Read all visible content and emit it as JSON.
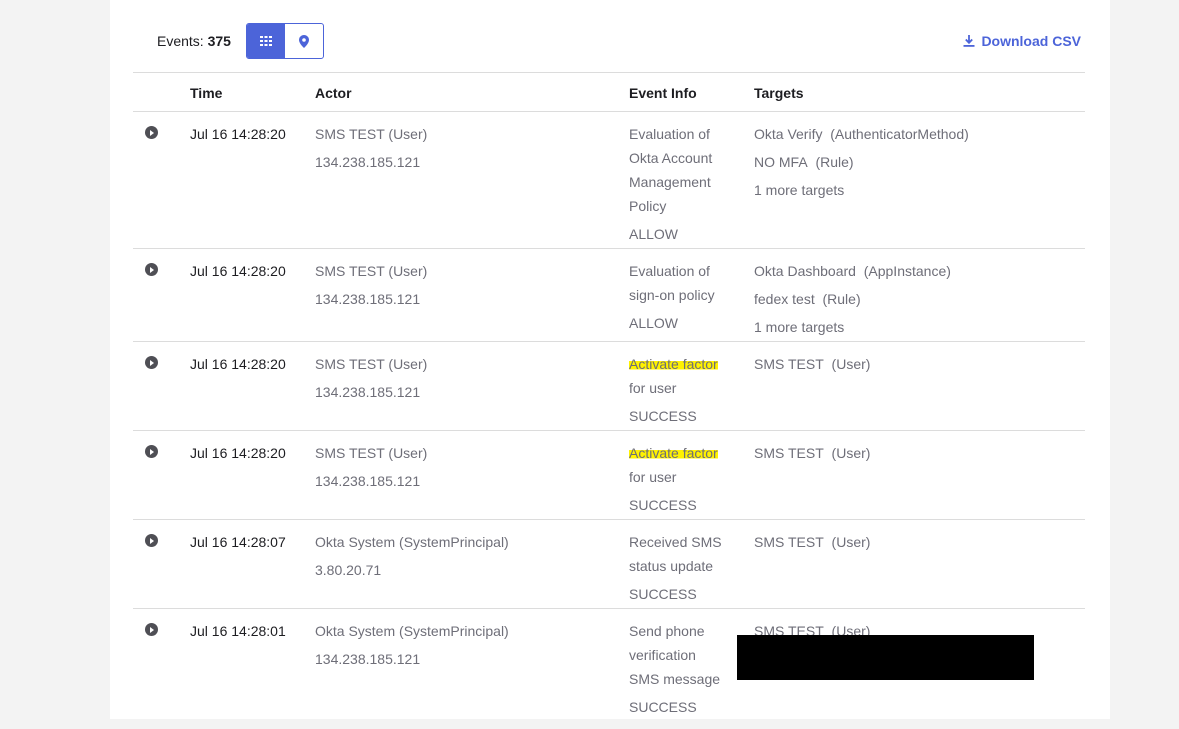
{
  "toolbar": {
    "events_label": "Events:",
    "events_count": "375",
    "grid_view_icon": "grid-icon",
    "map_view_icon": "map-pin-icon",
    "download_label": "Download CSV",
    "download_icon": "download-icon",
    "accent_color": "#4c64d9"
  },
  "columns": {
    "time": "Time",
    "actor": "Actor",
    "event_info": "Event Info",
    "targets": "Targets"
  },
  "rows": [
    {
      "time": "Jul 16 14:28:20",
      "actor_name": "SMS TEST",
      "actor_type": "(User)",
      "actor_ip": "134.238.185.121",
      "info_lines": [
        "Evaluation of",
        "Okta Account",
        "Management",
        "Policy"
      ],
      "outcome": "ALLOW",
      "targets": [
        {
          "name": "Okta Verify",
          "type": "(AuthenticatorMethod)"
        },
        {
          "name": "NO MFA",
          "type": "(Rule)"
        }
      ],
      "more_targets": "1 more targets"
    },
    {
      "time": "Jul 16 14:28:20",
      "actor_name": "SMS TEST",
      "actor_type": "(User)",
      "actor_ip": "134.238.185.121",
      "info_lines": [
        "Evaluation of",
        "sign-on policy"
      ],
      "outcome": "ALLOW",
      "targets": [
        {
          "name": "Okta Dashboard",
          "type": "(AppInstance)"
        },
        {
          "name": "fedex test",
          "type": "(Rule)"
        }
      ],
      "more_targets": "1 more targets"
    },
    {
      "time": "Jul 16 14:28:20",
      "actor_name": "SMS TEST",
      "actor_type": "(User)",
      "actor_ip": "134.238.185.121",
      "info_lines": [
        "Activate factor",
        "for user"
      ],
      "outcome": "SUCCESS",
      "targets": [
        {
          "name": "SMS TEST",
          "type": "(User)"
        }
      ],
      "more_targets": ""
    },
    {
      "time": "Jul 16 14:28:20",
      "actor_name": "SMS TEST",
      "actor_type": "(User)",
      "actor_ip": "134.238.185.121",
      "info_lines": [
        "Activate factor",
        "for user"
      ],
      "outcome": "SUCCESS",
      "targets": [
        {
          "name": "SMS TEST",
          "type": "(User)"
        }
      ],
      "more_targets": ""
    },
    {
      "time": "Jul 16 14:28:07",
      "actor_name": "Okta System",
      "actor_type": "(SystemPrincipal)",
      "actor_ip": "3.80.20.71",
      "info_lines": [
        "Received SMS",
        "status update"
      ],
      "outcome": "SUCCESS",
      "targets": [
        {
          "name": "SMS TEST",
          "type": "(User)"
        }
      ],
      "more_targets": ""
    },
    {
      "time": "Jul 16 14:28:01",
      "actor_name": "Okta System",
      "actor_type": "(SystemPrincipal)",
      "actor_ip": "134.238.185.121",
      "info_lines": [
        "Send phone",
        "verification",
        "SMS message"
      ],
      "outcome": "SUCCESS",
      "targets": [
        {
          "name": "SMS TEST",
          "type": "(User)"
        }
      ],
      "more_targets": ""
    }
  ]
}
